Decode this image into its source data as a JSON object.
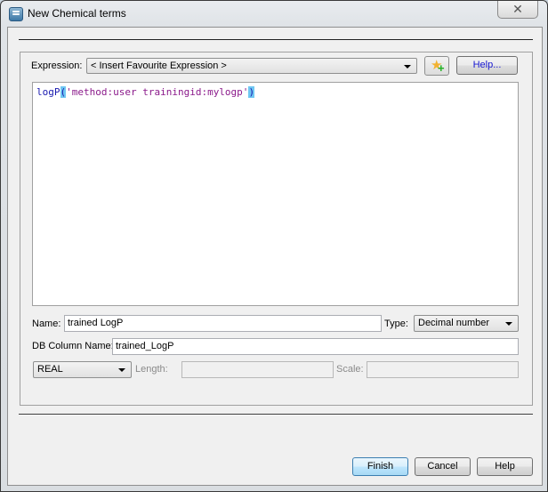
{
  "window": {
    "title": "New Chemical terms",
    "close_glyph": "✕"
  },
  "expression": {
    "label": "Expression:",
    "favourite_select": "< Insert Favourite Expression >",
    "add_favourite_icon": "star-plus-icon",
    "help_label": "Help...",
    "code": {
      "function": "logP",
      "open_paren": "(",
      "argument": "'method:user trainingid:mylogp'",
      "close_paren": ")"
    }
  },
  "fields": {
    "name_label": "Name:",
    "name_value": "trained LogP",
    "type_label": "Type:",
    "type_value": "Decimal number",
    "db_column_label": "DB Column Name:",
    "db_column_value": "trained_LogP",
    "sql_type_value": "REAL",
    "length_label": "Length:",
    "length_value": "",
    "scale_label": "Scale:",
    "scale_value": ""
  },
  "buttons": {
    "finish": "Finish",
    "cancel": "Cancel",
    "help": "Help"
  }
}
